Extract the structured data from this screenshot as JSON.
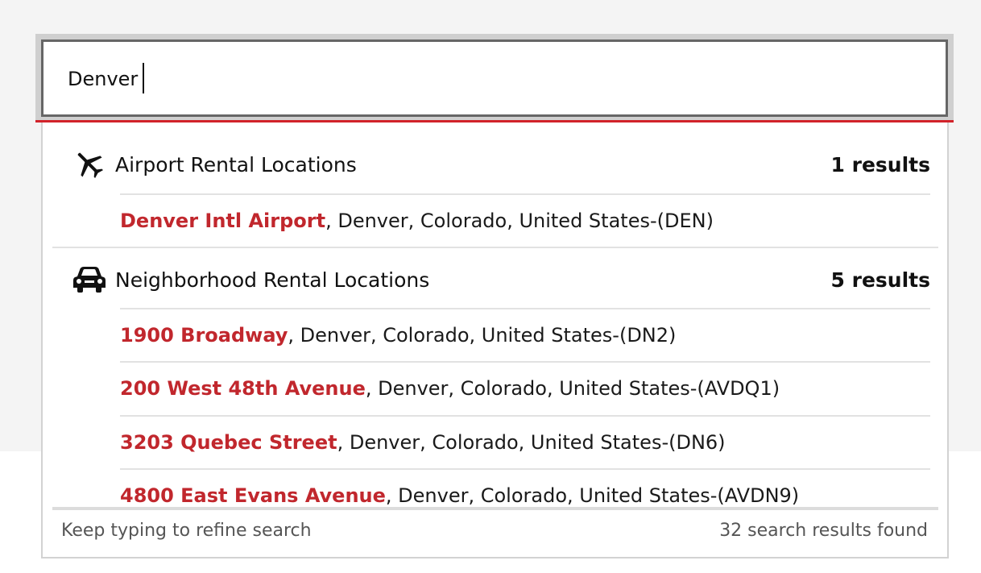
{
  "search": {
    "value": "Denver"
  },
  "groups": [
    {
      "title": "Airport Rental Locations",
      "count": "1 results",
      "icon": "airplane-icon",
      "items": [
        {
          "name": "Denver Intl Airport",
          "detail": ", Denver, Colorado, United States-(DEN)"
        }
      ]
    },
    {
      "title": "Neighborhood Rental Locations",
      "count": "5 results",
      "icon": "car-icon",
      "items": [
        {
          "name": "1900 Broadway",
          "detail": ", Denver, Colorado, United States-(DN2)"
        },
        {
          "name": "200 West 48th Avenue",
          "detail": ", Denver, Colorado, United States-(AVDQ1)"
        },
        {
          "name": "3203 Quebec Street",
          "detail": ", Denver, Colorado, United States-(DN6)"
        },
        {
          "name": "4800 East Evans Avenue",
          "detail": ", Denver, Colorado, United States-(AVDN9)"
        }
      ]
    }
  ],
  "footer": {
    "hint": "Keep typing to refine search",
    "total": "32 search results found"
  },
  "colors": {
    "accent": "#d2232a",
    "location_name": "#c1272d"
  }
}
